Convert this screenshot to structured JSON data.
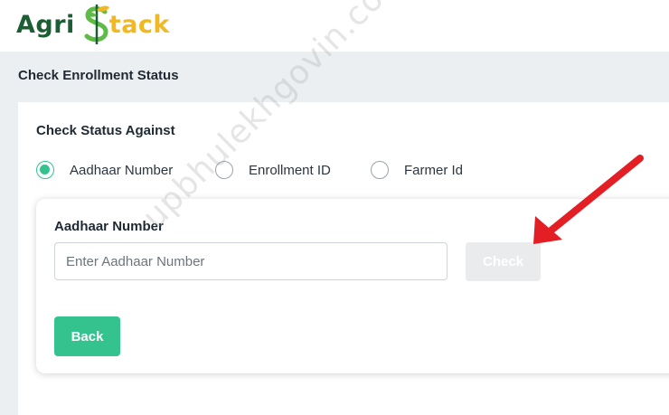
{
  "header": {
    "logo_part1": "Agri",
    "logo_part2": "tack",
    "logo_full": "Agri Stack"
  },
  "page": {
    "title": "Check Enrollment Status"
  },
  "status_form": {
    "heading": "Check Status Against",
    "options": [
      {
        "label": "Aadhaar Number",
        "selected": true
      },
      {
        "label": "Enrollment ID",
        "selected": false
      },
      {
        "label": "Farmer Id",
        "selected": false
      }
    ],
    "field_label": "Aadhaar Number",
    "input_value": "",
    "input_placeholder": "Enter Aadhaar Number",
    "check_label": "Check",
    "back_label": "Back"
  },
  "watermark": "upbhulekhgovin.com",
  "colors": {
    "accent": "#34c38f",
    "logo_green": "#1b5e34",
    "logo_yellow": "#f2b824",
    "arrow": "#e31e24",
    "disabled_button": "#e9ebec",
    "page_background": "#eceff1"
  }
}
